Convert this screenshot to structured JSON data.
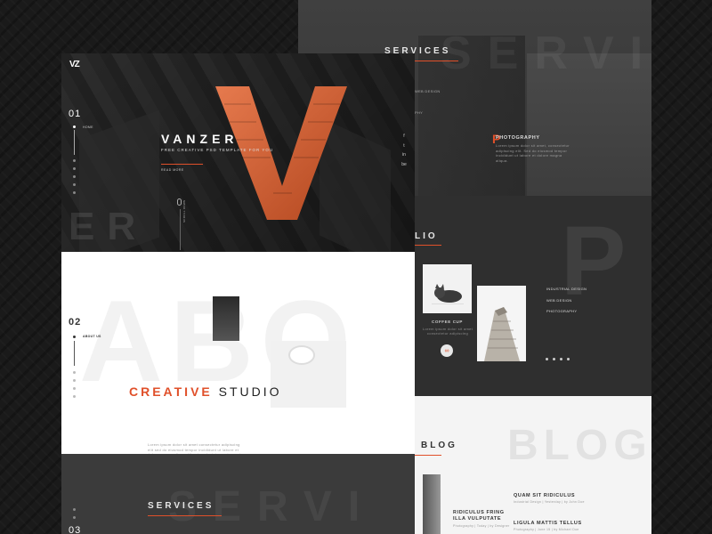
{
  "brand": {
    "logo": "VZ"
  },
  "hero": {
    "index": "01",
    "nav_label": "HOME",
    "title": "VANZER",
    "subtitle": "FREE CREATIVE PSD TEMPLATE FOR YOU",
    "cta": "READ MORE",
    "big_letter": "V",
    "ghost_text": "ER",
    "scroll_label": "SCROLL DOWN",
    "accent": "#e0502a"
  },
  "social": {
    "items": [
      "f",
      "t",
      "in",
      "be"
    ]
  },
  "about": {
    "index": "02",
    "nav_label": "ABOUT US",
    "title_accent": "CREATIVE",
    "title_rest": "STUDIO",
    "ghost_text": "ABO",
    "body": "Lorem ipsum dolor sit amet consectetur adipiscing elit sed do eiusmod tempor incididunt ut labore et dolore magna aliqua. Ut enim ad minim veniam quis nostrud exercitation."
  },
  "services_front": {
    "title": "SERVICES",
    "index": "03",
    "ghost_text": "SERVI"
  },
  "services_back": {
    "title": "SERVICES",
    "ghost_text": "SERVI",
    "item_title": "PHOTOGRAPHY",
    "item_letter": "P",
    "item_body": "Lorem ipsum dolor sit amet, consectetur adipiscing elit. Sed do eiusmod tempor incididunt ut labore et dolore magna aliqua.",
    "side_items": [
      "WEB DESIGN",
      "PHY"
    ]
  },
  "portfolio": {
    "title": "LIO",
    "ghost_letter": "P",
    "card_title": "COFFEE CUP",
    "card_text": "Lorem ipsum dolor sit amet consectetur adipiscing",
    "categories": [
      "INDUSTRIAL DESIGN",
      "WEB DESIGN",
      "PHOTOGRAPHY"
    ]
  },
  "blog": {
    "title": "BLOG",
    "ghost_text": "BLOG",
    "posts": [
      {
        "title": "QUAM SIT RIDICULUS",
        "meta": "Industrial Design  |  Yesterday  |  by John Doe"
      },
      {
        "title": "RIDICULUS FRING\nILLA VULPUTATE",
        "meta": "Photography  |  Today  |  by Designer"
      },
      {
        "title": "LIGULA MATTIS TELLUS",
        "meta": "Photography  |  June 15  |  by Michael Doe"
      }
    ]
  }
}
